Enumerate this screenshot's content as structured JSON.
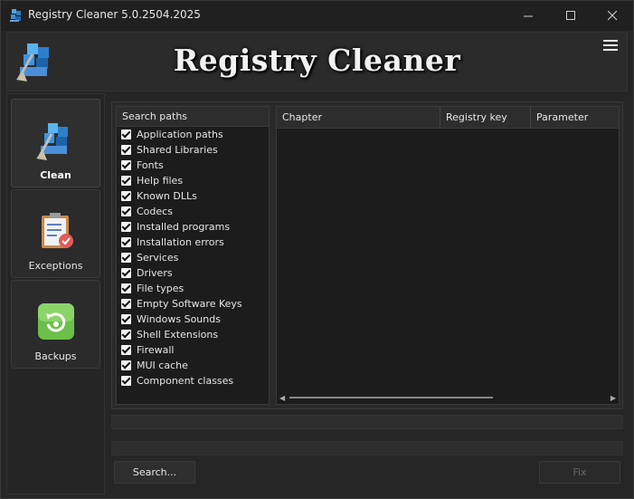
{
  "window": {
    "title": "Registry Cleaner 5.0.2504.2025"
  },
  "header": {
    "app_title": "Registry Cleaner"
  },
  "sidebar": {
    "items": [
      {
        "label": "Clean",
        "active": true
      },
      {
        "label": "Exceptions",
        "active": false
      },
      {
        "label": "Backups",
        "active": false
      }
    ]
  },
  "search_paths": {
    "header": "Search paths",
    "items": [
      {
        "label": "Application paths",
        "checked": true
      },
      {
        "label": "Shared Libraries",
        "checked": true
      },
      {
        "label": "Fonts",
        "checked": true
      },
      {
        "label": "Help files",
        "checked": true
      },
      {
        "label": "Known DLLs",
        "checked": true
      },
      {
        "label": "Codecs",
        "checked": true
      },
      {
        "label": "Installed programs",
        "checked": true
      },
      {
        "label": "Installation errors",
        "checked": true
      },
      {
        "label": "Services",
        "checked": true
      },
      {
        "label": "Drivers",
        "checked": true
      },
      {
        "label": "File types",
        "checked": true
      },
      {
        "label": "Empty Software Keys",
        "checked": true
      },
      {
        "label": "Windows Sounds",
        "checked": true
      },
      {
        "label": "Shell Extensions",
        "checked": true
      },
      {
        "label": "Firewall",
        "checked": true
      },
      {
        "label": "MUI cache",
        "checked": true
      },
      {
        "label": "Component classes",
        "checked": true
      }
    ]
  },
  "results": {
    "columns": [
      "Chapter",
      "Registry key",
      "Parameter"
    ]
  },
  "buttons": {
    "search": "Search...",
    "fix": "Fix"
  },
  "colors": {
    "background": "#262626",
    "panel": "#1c1c1c",
    "text": "#e6e6e6",
    "disabled_text": "#666666"
  }
}
